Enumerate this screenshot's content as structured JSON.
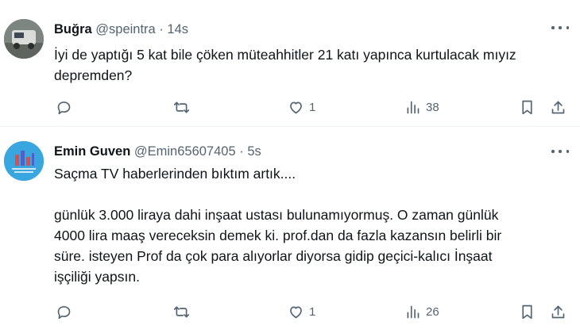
{
  "tweets": [
    {
      "name": "Buğra",
      "handle": "@speintra",
      "separator": "·",
      "time": "14s",
      "paragraphs": [
        "İyi de yaptığı 5 kat bile çöken müteahhitler 21 katı yapınca kurtulacak mıyız\ndepremden?"
      ],
      "actions": {
        "replies": "",
        "retweets": "",
        "likes": "1",
        "views": "38"
      }
    },
    {
      "name": "Emin Guven",
      "handle": "@Emin65607405",
      "separator": "·",
      "time": "5s",
      "paragraphs": [
        "Saçma TV haberlerinden bıktım artık....",
        "günlük 3.000 liraya dahi inşaat ustası bulunamıyormuş. O zaman günlük\n4000 lira maaş vereceksin demek ki. prof.dan da fazla kazansın belirli bir\nsüre. isteyen Prof da çok para alıyorlar diyorsa gidip geçici-kalıcı İnşaat\nişçiliği yapsın."
      ],
      "actions": {
        "replies": "",
        "retweets": "",
        "likes": "1",
        "views": "26"
      }
    }
  ],
  "icons": {
    "reply": "reply-icon",
    "retweet": "retweet-icon",
    "like": "heart-icon",
    "views": "views-icon",
    "bookmark": "bookmark-icon",
    "share": "share-icon",
    "more": "more-icon"
  },
  "colors": {
    "text": "#0f1419",
    "secondary": "#536471",
    "divider": "#eff3f4",
    "avatar2": "#2aa1df"
  }
}
